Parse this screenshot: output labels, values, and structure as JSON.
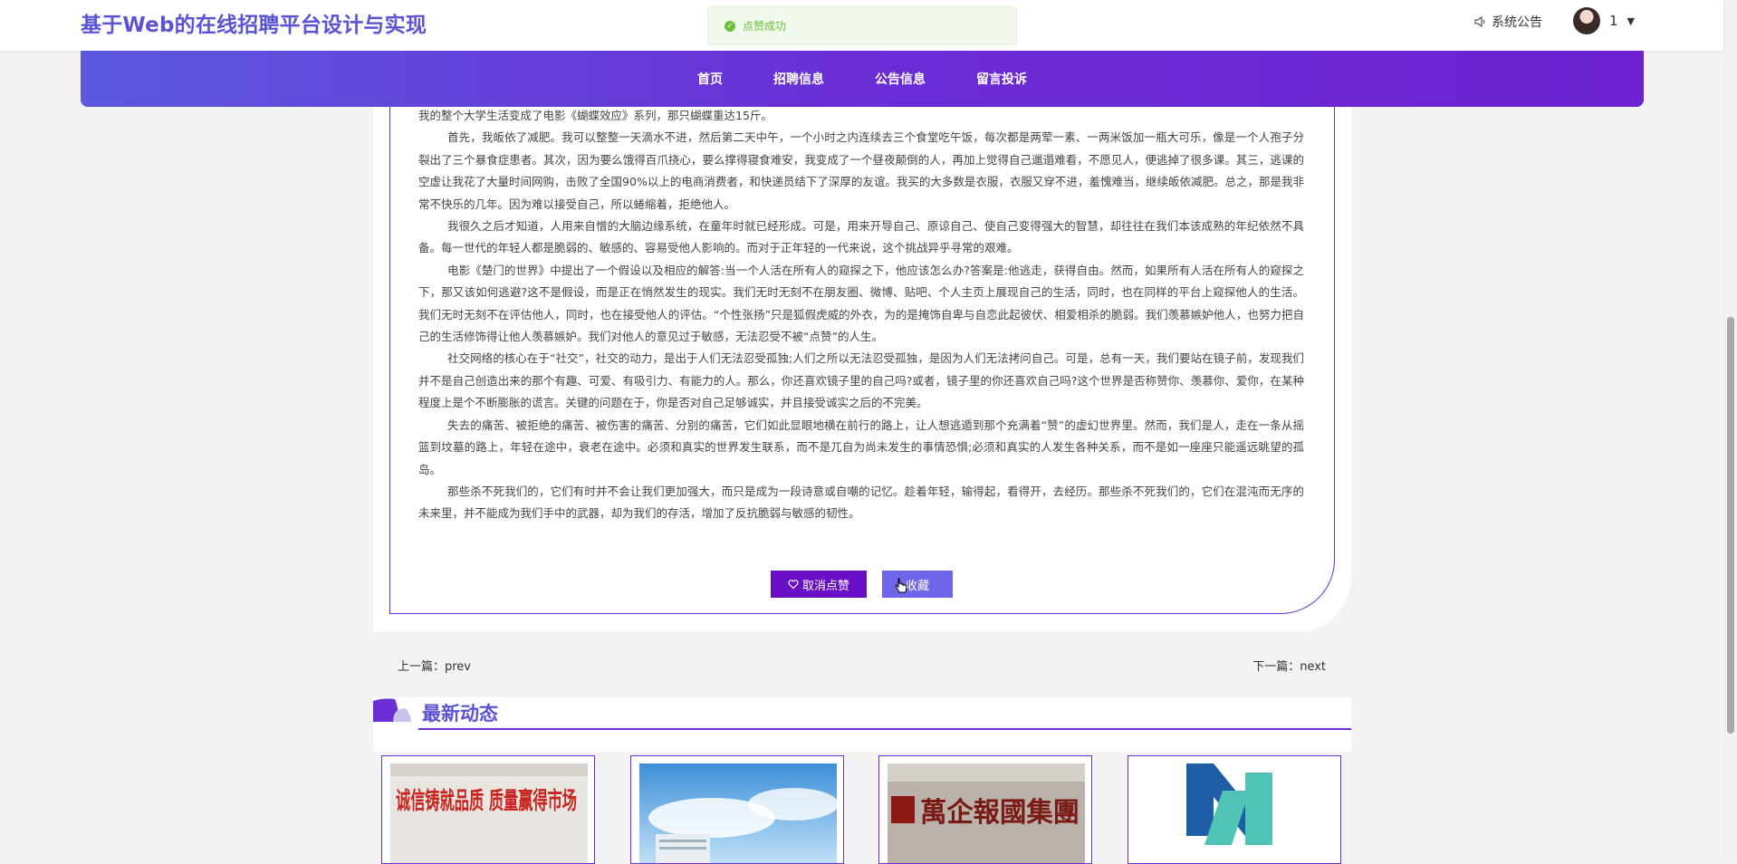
{
  "header": {
    "title": "基于Web的在线招聘平台设计与实现",
    "notice_label": "系统公告",
    "user_name": "1"
  },
  "toast": {
    "message": "点赞成功"
  },
  "nav": {
    "items": [
      "首页",
      "招聘信息",
      "公告信息",
      "留言投诉"
    ]
  },
  "article": {
    "paragraphs": [
      "我的整个大学生活变成了电影《蝴蝶效应》系列，那只蝴蝶重达15斤。",
      "首先，我皈依了减肥。我可以整整一天滴水不进，然后第二天中午，一个小时之内连续去三个食堂吃午饭，每次都是两荤一素、一两米饭加一瓶大可乐，像是一个人孢子分裂出了三个暴食症患者。其次，因为要么饿得百爪挠心，要么撑得寝食难安，我变成了一个昼夜颠倒的人，再加上觉得自己邋遢难看，不愿见人，便逃掉了很多课。其三，逃课的空虚让我花了大量时间网购，击败了全国90%以上的电商消费者，和快递员结下了深厚的友谊。我买的大多数是衣服，衣服又穿不进，羞愧难当，继续皈依减肥。总之，那是我非常不快乐的几年。因为难以接受自己，所以蜷缩着，拒绝他人。",
      "我很久之后才知道，人用来自憎的大脑边缘系统，在童年时就已经形成。可是，用来开导自己、原谅自己、使自己变得强大的智慧，却往往在我们本该成熟的年纪依然不具备。每一世代的年轻人都是脆弱的、敏感的、容易受他人影响的。而对于正年轻的一代来说，这个挑战异乎寻常的艰难。",
      "电影《楚门的世界》中提出了一个假设以及相应的解答:当一个人活在所有人的窥探之下，他应该怎么办?答案是:他逃走，获得自由。然而，如果所有人活在所有人的窥探之下，那又该如何逃避?这不是假设，而是正在悄然发生的现实。我们无时无刻不在朋友圈、微博、贴吧、个人主页上展现自己的生活，同时，也在同样的平台上窥探他人的生活。我们无时无刻不在评估他人，同时，也在接受他人的评估。“个性张扬”只是狐假虎威的外衣，为的是掩饰自卑与自恋此起彼伏、相爱相杀的脆弱。我们羡慕嫉妒他人，也努力把自己的生活修饰得让他人羡慕嫉妒。我们对他人的意见过于敏感，无法忍受不被“点赞”的人生。",
      "社交网络的核心在于“社交”，社交的动力，是出于人们无法忍受孤独;人们之所以无法忍受孤独，是因为人们无法拷问自己。可是，总有一天，我们要站在镜子前，发现我们并不是自己创造出来的那个有趣、可爱、有吸引力、有能力的人。那么，你还喜欢镜子里的自己吗?或者，镜子里的你还喜欢自己吗?这个世界是否称赞你、羡慕你、爱你，在某种程度上是个不断膨胀的谎言。关键的问题在于，你是否对自己足够诚实，并且接受诚实之后的不完美。",
      "失去的痛苦、被拒绝的痛苦、被伤害的痛苦、分别的痛苦，它们如此显眼地横在前行的路上，让人想逃遁到那个充满着“赞”的虚幻世界里。然而，我们是人，走在一条从摇篮到坟墓的路上，年轻在途中，衰老在途中。必须和真实的世界发生联系，而不是兀自为尚未发生的事情恐惧;必须和真实的人发生各种关系，而不是如一座座只能遥远眺望的孤岛。",
      "那些杀不死我们的，它们有时并不会让我们更加强大，而只是成为一段诗意或自嘲的记忆。趁着年轻，输得起，看得开，去经历。那些杀不死我们的，它们在混沌而无序的未来里，并不能成为我们手中的武器，却为我们的存活，增加了反抗脆弱与敏感的韧性。"
    ],
    "unlike_label": "取消点赞",
    "favorite_label": "收藏"
  },
  "pager": {
    "prev": "上一篇：prev",
    "next": "下一篇：next"
  },
  "latest": {
    "title": "最新动态",
    "cards": [
      {
        "image": "integrity-quality-wall",
        "caption": "诚信铸就品质 质量赢得市场"
      },
      {
        "image": "office-building-sky"
      },
      {
        "image": "company-logo-wall",
        "caption": "萬企報國集團"
      },
      {
        "image": "n-logo"
      }
    ]
  },
  "colors": {
    "brand": "#5b53d3",
    "nav_start": "#5c59dd",
    "nav_end": "#6c22d0",
    "accent": "#6a2dd6",
    "success": "#67c23a"
  }
}
